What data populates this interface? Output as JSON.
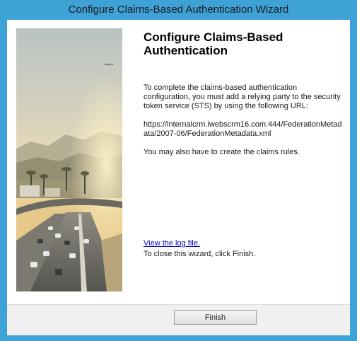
{
  "window": {
    "title": "Configure Claims-Based Authentication Wizard"
  },
  "main": {
    "heading": "Configure Claims-Based Authentication",
    "instructions": "To complete the claims-based authentication configuration, you must add a relying party to the security token service (STS) by using the following URL:",
    "url": "https://internalcrm.iwebscrm16.com:444/FederationMetadata/2007-06/FederationMetadata.xml",
    "claims_note": "You may also have to create the claims rules.",
    "log_link": "View the log file.",
    "close_hint": "To close this wizard, click Finish."
  },
  "footer": {
    "finish_label": "Finish"
  },
  "colors": {
    "titlebar": "#3ea2d7",
    "link": "#0000cc",
    "client_bg": "#ffffff",
    "footer_bg": "#f0f0f0"
  }
}
